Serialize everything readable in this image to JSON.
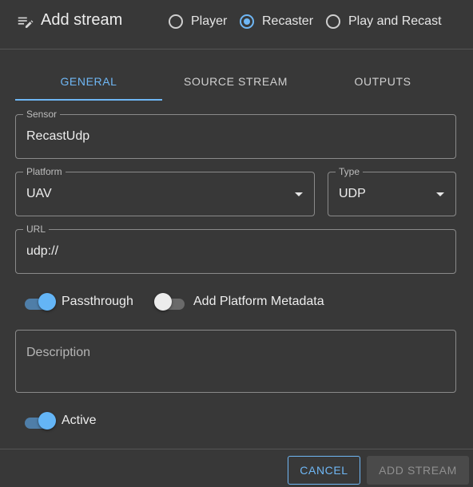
{
  "header": {
    "title": "Add stream",
    "modes": [
      {
        "label": "Player",
        "checked": false
      },
      {
        "label": "Recaster",
        "checked": true
      },
      {
        "label": "Play and Recast",
        "checked": false
      }
    ]
  },
  "tabs": [
    {
      "label": "GENERAL",
      "active": true
    },
    {
      "label": "SOURCE STREAM",
      "active": false
    },
    {
      "label": "OUTPUTS",
      "active": false
    }
  ],
  "form": {
    "sensor": {
      "label": "Sensor",
      "value": "RecastUdp"
    },
    "platform": {
      "label": "Platform",
      "value": "UAV"
    },
    "type": {
      "label": "Type",
      "value": "UDP"
    },
    "url": {
      "label": "URL",
      "value": "udp://"
    },
    "passthrough": {
      "label": "Passthrough",
      "on": true
    },
    "add_platform_metadata": {
      "label": "Add Platform Metadata",
      "on": false
    },
    "description": {
      "placeholder": "Description",
      "value": ""
    },
    "active": {
      "label": "Active",
      "on": true
    }
  },
  "footer": {
    "cancel_label": "CANCEL",
    "add_label": "ADD STREAM"
  },
  "colors": {
    "background": "#383838",
    "accent": "#6fb7f5"
  }
}
